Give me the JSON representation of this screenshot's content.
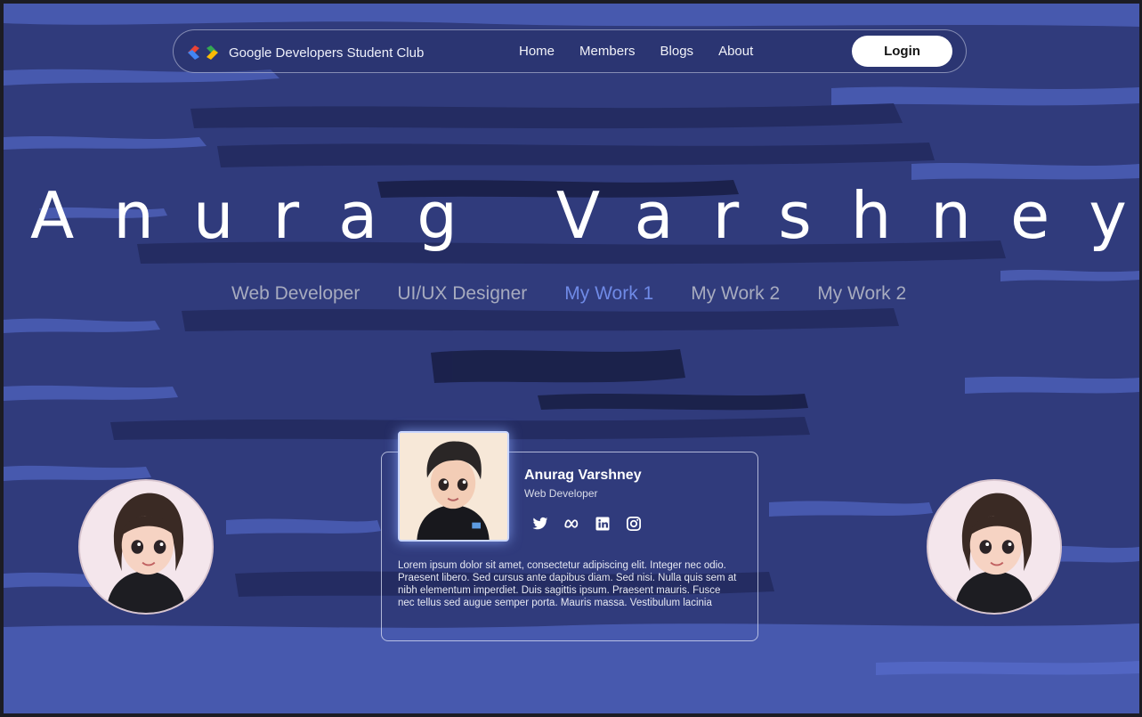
{
  "nav": {
    "brand": "Google Developers Student Club",
    "links": [
      "Home",
      "Members",
      "Blogs",
      "About"
    ],
    "login_label": "Login"
  },
  "hero": {
    "name": "Anurag Varshney",
    "roles": [
      "Web Developer",
      "UI/UX Designer",
      "My Work 1",
      "My Work 2",
      "My Work 2"
    ],
    "active_role": "My Work 1"
  },
  "profile": {
    "name": "Anurag Varshney",
    "role": "Web Developer",
    "socials": [
      "twitter-icon",
      "meta-icon",
      "linkedin-icon",
      "instagram-icon"
    ],
    "bio": "Lorem ipsum dolor sit amet, consectetur adipiscing elit. Integer nec odio. Praesent libero. Sed cursus ante dapibus diam. Sed nisi. Nulla quis sem at nibh elementum imperdiet. Duis sagittis ipsum. Praesent mauris. Fusce nec tellus sed augue semper porta. Mauris massa. Vestibulum lacinia"
  },
  "colors": {
    "background": "#2f3a7a",
    "accent": "#6f8ae6",
    "muted_role": "#a7abbf"
  }
}
